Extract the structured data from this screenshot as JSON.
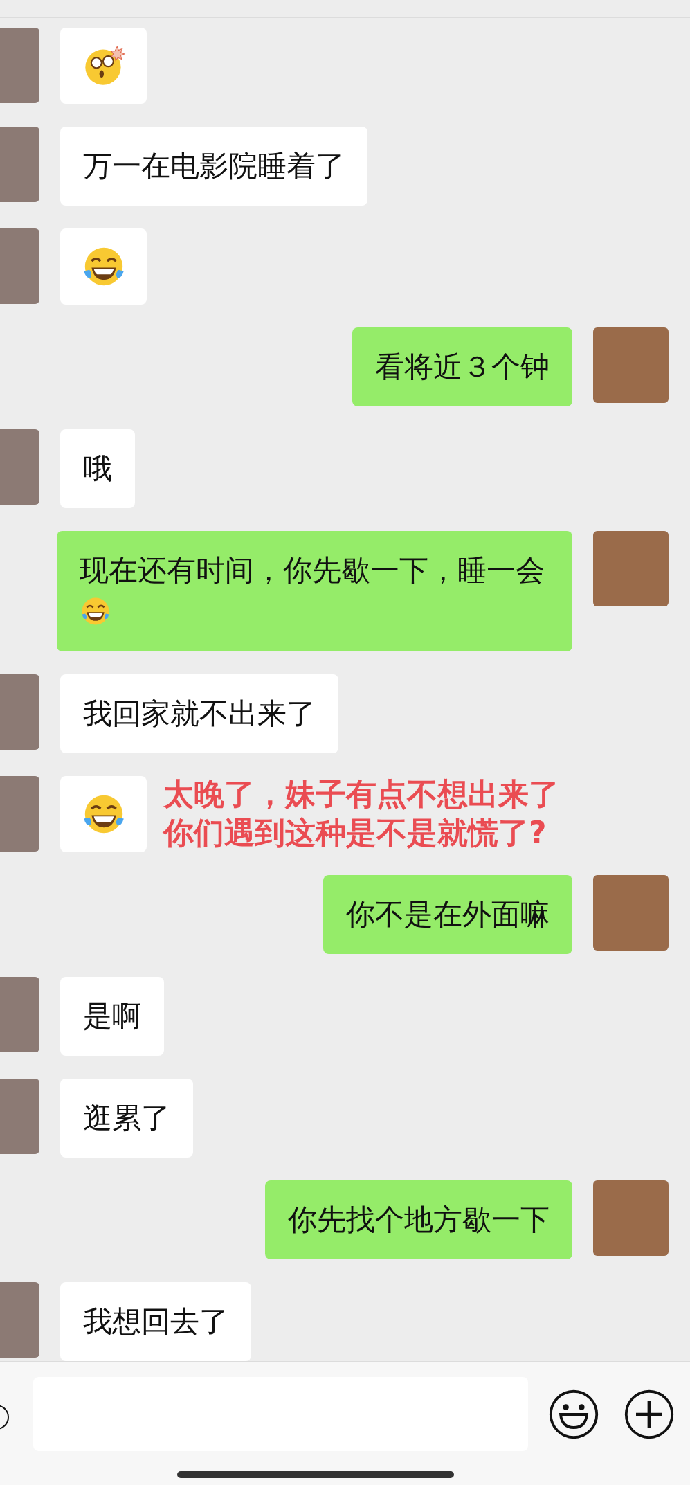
{
  "messages": [
    {
      "outgoing": false,
      "parts": [
        {
          "kind": "shock"
        }
      ]
    },
    {
      "outgoing": false,
      "parts": [
        {
          "kind": "text",
          "text": "万一在电影院睡着了"
        }
      ]
    },
    {
      "outgoing": false,
      "parts": [
        {
          "kind": "laugh"
        }
      ]
    },
    {
      "outgoing": true,
      "parts": [
        {
          "kind": "text",
          "text": "看将近３个钟"
        }
      ]
    },
    {
      "outgoing": false,
      "parts": [
        {
          "kind": "text",
          "text": "哦"
        }
      ]
    },
    {
      "outgoing": true,
      "parts": [
        {
          "kind": "text",
          "text": "现在还有时间，你先歇一下，睡一会"
        },
        {
          "kind": "laugh"
        }
      ]
    },
    {
      "outgoing": false,
      "parts": [
        {
          "kind": "text",
          "text": "我回家就不出来了"
        }
      ]
    },
    {
      "outgoing": false,
      "parts": [
        {
          "kind": "laugh"
        }
      ],
      "annotation": [
        "太晚了，妹子有点不想出来了",
        "你们遇到这种是不是就慌了?"
      ]
    },
    {
      "outgoing": true,
      "parts": [
        {
          "kind": "text",
          "text": "你不是在外面嘛"
        }
      ]
    },
    {
      "outgoing": false,
      "parts": [
        {
          "kind": "text",
          "text": "是啊"
        }
      ]
    },
    {
      "outgoing": false,
      "parts": [
        {
          "kind": "text",
          "text": "逛累了"
        }
      ]
    },
    {
      "outgoing": true,
      "parts": [
        {
          "kind": "text",
          "text": "你先找个地方歇一下"
        }
      ]
    },
    {
      "outgoing": false,
      "parts": [
        {
          "kind": "text",
          "text": "我想回去了"
        }
      ]
    }
  ]
}
